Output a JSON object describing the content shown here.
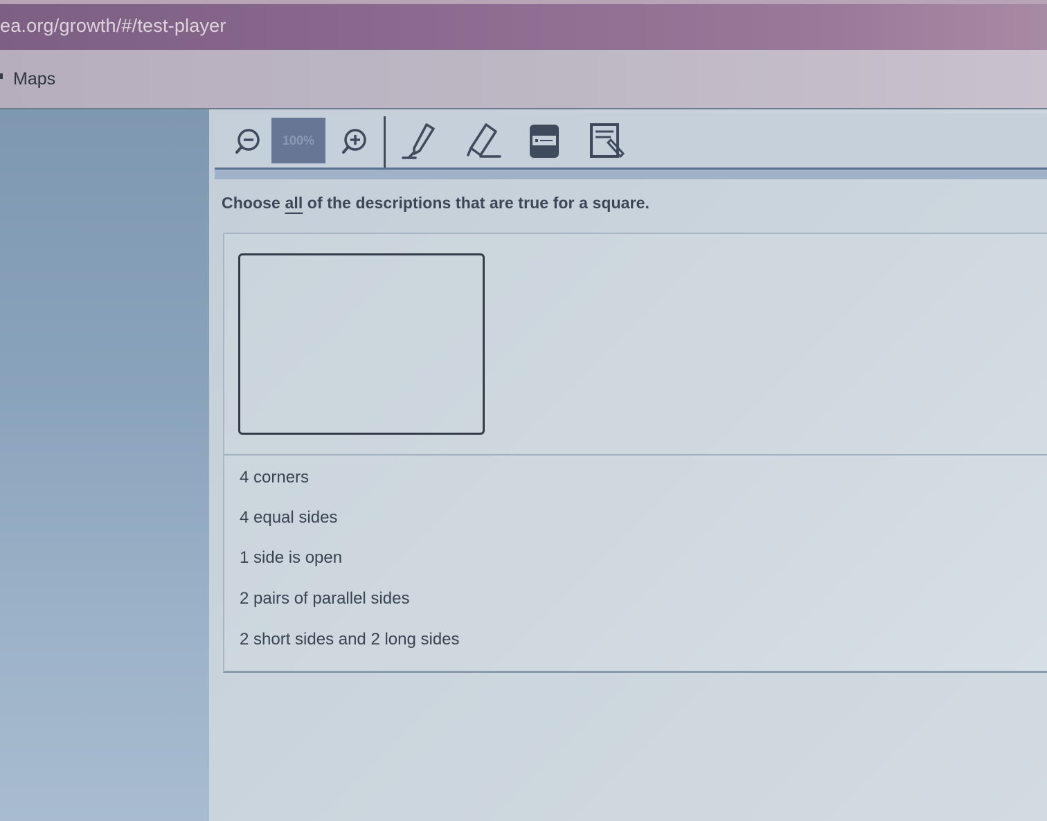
{
  "browser": {
    "url": "ea.org/growth/#/test-player",
    "bookmark_label": "Maps"
  },
  "toolbar": {
    "zoom_out_icon": "zoom-out-icon",
    "zoom_level": "100%",
    "zoom_in_icon": "zoom-in-icon",
    "highlighter_icon": "highlighter-icon",
    "eraser_icon": "eraser-icon",
    "line-reader_icon": "line-reader-icon",
    "notepad_icon": "notepad-icon"
  },
  "question": {
    "prefix": "Choose ",
    "emphasis": "all",
    "suffix": " of the descriptions that are true for a square."
  },
  "options": [
    {
      "label": "4 corners"
    },
    {
      "label": "4 equal sides"
    },
    {
      "label": "1 side is open"
    },
    {
      "label": "2 pairs of parallel sides"
    },
    {
      "label": "2 short sides and 2 long sides"
    }
  ],
  "colors": {
    "accent": "#5b7190",
    "zoom_bg": "#667694",
    "text": "#3a4352"
  }
}
